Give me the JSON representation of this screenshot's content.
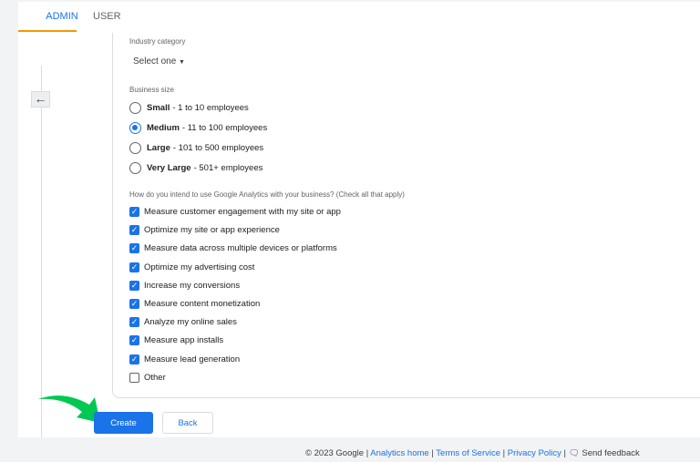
{
  "tabs": [
    {
      "label": "ADMIN",
      "active": true
    },
    {
      "label": "USER",
      "active": false
    }
  ],
  "form": {
    "industry_label": "Industry category",
    "industry_value": "Select one",
    "business_size_label": "Business size",
    "sizes": [
      {
        "name": "Small",
        "desc": "- 1 to 10 employees",
        "selected": false
      },
      {
        "name": "Medium",
        "desc": "- 11 to 100 employees",
        "selected": true
      },
      {
        "name": "Large",
        "desc": "- 101 to 500 employees",
        "selected": false
      },
      {
        "name": "Very Large",
        "desc": "- 501+ employees",
        "selected": false
      }
    ],
    "usage_label": "How do you intend to use Google Analytics with your business? (Check all that apply)",
    "usage": [
      {
        "label": "Measure customer engagement with my site or app",
        "checked": true
      },
      {
        "label": "Optimize my site or app experience",
        "checked": true
      },
      {
        "label": "Measure data across multiple devices or platforms",
        "checked": true
      },
      {
        "label": "Optimize my advertising cost",
        "checked": true
      },
      {
        "label": "Increase my conversions",
        "checked": true
      },
      {
        "label": "Measure content monetization",
        "checked": true
      },
      {
        "label": "Analyze my online sales",
        "checked": true
      },
      {
        "label": "Measure app installs",
        "checked": true
      },
      {
        "label": "Measure lead generation",
        "checked": true
      },
      {
        "label": "Other",
        "checked": false
      }
    ]
  },
  "buttons": {
    "create": "Create",
    "back": "Back"
  },
  "footer": {
    "copyright": "© 2023 Google",
    "analytics_home": "Analytics home",
    "terms": "Terms of Service",
    "privacy": "Privacy Policy",
    "feedback": "Send feedback",
    "sep": "|"
  },
  "colors": {
    "accent": "#1a73e8",
    "tab_underline": "#f29900",
    "annotation_arrow": "#00c853"
  }
}
